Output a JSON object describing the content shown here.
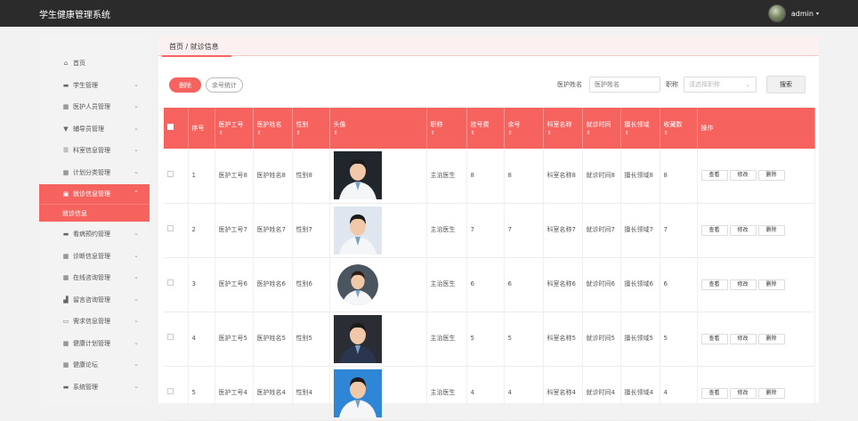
{
  "header": {
    "app_title": "学生健康管理系统",
    "username": "admin",
    "caret": "▾"
  },
  "sidebar": {
    "items": [
      {
        "label": "首页",
        "icon": "home-icon",
        "glyph": "⌂",
        "has_chevron": false
      },
      {
        "label": "学生管理",
        "icon": "card-icon",
        "glyph": "▬",
        "has_chevron": true
      },
      {
        "label": "医护人员管理",
        "icon": "grid-icon",
        "glyph": "▦",
        "has_chevron": true
      },
      {
        "label": "辅导员管理",
        "icon": "shield-icon",
        "glyph": "▼",
        "has_chevron": true
      },
      {
        "label": "科室信息管理",
        "icon": "list-icon",
        "glyph": "☰",
        "has_chevron": true
      },
      {
        "label": "计划分类管理",
        "icon": "grid-icon",
        "glyph": "▦",
        "has_chevron": true
      },
      {
        "label": "就诊信息管理",
        "icon": "clipboard-icon",
        "glyph": "▣",
        "has_chevron": true,
        "active": true
      },
      {
        "label": "看病预约管理",
        "icon": "card-icon",
        "glyph": "▬",
        "has_chevron": true
      },
      {
        "label": "诊断信息管理",
        "icon": "grid-icon",
        "glyph": "▦",
        "has_chevron": true
      },
      {
        "label": "在线咨询管理",
        "icon": "grid-icon",
        "glyph": "▦",
        "has_chevron": true
      },
      {
        "label": "留言咨询管理",
        "icon": "chart-icon",
        "glyph": "▟",
        "has_chevron": true
      },
      {
        "label": "需求信息管理",
        "icon": "monitor-icon",
        "glyph": "▭",
        "has_chevron": true
      },
      {
        "label": "健康计划管理",
        "icon": "grid-icon",
        "glyph": "▦",
        "has_chevron": true
      },
      {
        "label": "健康论坛",
        "icon": "grid-icon",
        "glyph": "▦",
        "has_chevron": true
      },
      {
        "label": "系统管理",
        "icon": "card-icon",
        "glyph": "▬",
        "has_chevron": true
      }
    ],
    "active_sub": "就诊信息",
    "chevron_down": "⌄",
    "chevron_up": "⌃"
  },
  "breadcrumb": "首页 / 就诊信息",
  "toolbar": {
    "delete_label": "删除",
    "stats_label": "余号统计"
  },
  "search": {
    "name_label": "医护姓名",
    "name_placeholder": "医护姓名",
    "title_label": "职称",
    "title_placeholder": "请选择职称",
    "button_label": "搜索"
  },
  "table": {
    "columns": [
      "序号",
      "医护工号",
      "医护姓名",
      "性别",
      "头像",
      "职称",
      "挂号费",
      "余号",
      "科室名称",
      "就诊时间",
      "擅长领域",
      "收藏数",
      "操作"
    ],
    "sort_glyph": "⇕",
    "rows": [
      {
        "index": "1",
        "staff_id": "医护工号8",
        "staff_name": "医护姓名8",
        "gender": "性别8",
        "title": "主治医生",
        "fee": "8",
        "remaining": "8",
        "dept": "科室名称8",
        "time": "就诊时间8",
        "specialty": "擅长领域8",
        "favorites": "8",
        "photo": "doctor-white-coat-dark-bg"
      },
      {
        "index": "2",
        "staff_id": "医护工号7",
        "staff_name": "医护姓名7",
        "gender": "性别7",
        "title": "主治医生",
        "fee": "7",
        "remaining": "7",
        "dept": "科室名称7",
        "time": "就诊时间7",
        "specialty": "擅长领域7",
        "favorites": "7",
        "photo": "doctor-white-coat-light-bg"
      },
      {
        "index": "3",
        "staff_id": "医护工号6",
        "staff_name": "医护姓名6",
        "gender": "性别6",
        "title": "主治医生",
        "fee": "6",
        "remaining": "6",
        "dept": "科室名称6",
        "time": "就诊时间6",
        "specialty": "擅长领域6",
        "favorites": "6",
        "photo": "doctor-female-round"
      },
      {
        "index": "4",
        "staff_id": "医护工号5",
        "staff_name": "医护姓名5",
        "gender": "性别5",
        "title": "主治医生",
        "fee": "5",
        "remaining": "5",
        "dept": "科室名称5",
        "time": "就诊时间5",
        "specialty": "擅长领域5",
        "favorites": "5",
        "photo": "doctor-suit"
      },
      {
        "index": "5",
        "staff_id": "医护工号4",
        "staff_name": "医护姓名4",
        "gender": "性别4",
        "title": "主治医生",
        "fee": "4",
        "remaining": "4",
        "dept": "科室名称4",
        "time": "就诊时间4",
        "specialty": "擅长领域4",
        "favorites": "4",
        "photo": "doctor-blue-bg"
      }
    ],
    "actions": {
      "view": "查看",
      "edit": "修改",
      "delete": "删除"
    }
  },
  "colors": {
    "accent": "#f6635f",
    "topbar": "#2b2b2b",
    "sidebar_bg": "#f3f3f3"
  }
}
